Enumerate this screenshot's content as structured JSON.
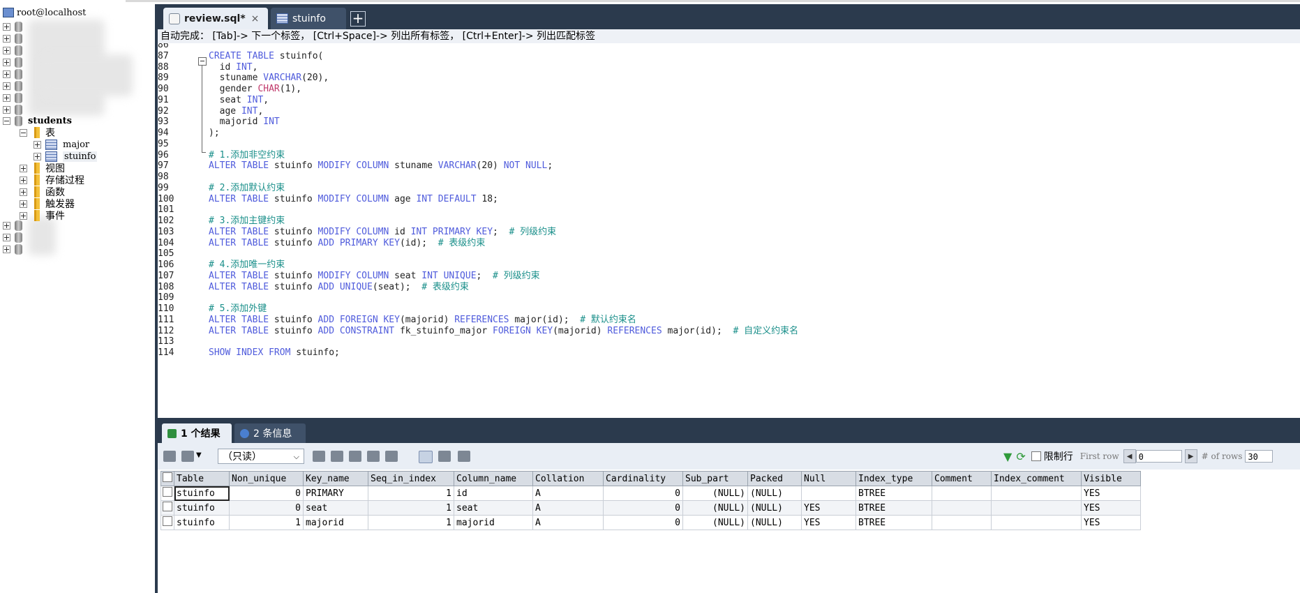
{
  "sidebar": {
    "connection": "root@localhost",
    "database": "students",
    "tables_folder": "表",
    "tables": [
      "major",
      "stuinfo"
    ],
    "folders": [
      "视图",
      "存储过程",
      "函数",
      "触发器",
      "事件"
    ]
  },
  "editor": {
    "tabs": [
      {
        "label": "review.sql*",
        "close": "×"
      },
      {
        "label": "stuinfo"
      }
    ],
    "add_tab": "+",
    "autocomplete_hint": "自动完成： [Tab]-> 下一个标签， [Ctrl+Space]-> 列出所有标签， [Ctrl+Enter]-> 列出匹配标签",
    "lines": [
      {
        "n": "86",
        "html": ""
      },
      {
        "n": "87",
        "html": "<span class='kw'>CREATE TABLE</span> <span class='pl'>stuinfo(</span>"
      },
      {
        "n": "88",
        "html": "  <span class='pl'>id</span> <span class='ty'>INT</span><span class='pl'>,</span>"
      },
      {
        "n": "89",
        "html": "  <span class='pl'>stuname</span> <span class='ty'>VARCHAR</span><span class='pl'>(20),</span>"
      },
      {
        "n": "90",
        "html": "  <span class='pl'>gender</span> <span class='ty2'>CHAR</span><span class='pl'>(1),</span>"
      },
      {
        "n": "91",
        "html": "  <span class='pl'>seat</span> <span class='ty'>INT</span><span class='pl'>,</span>"
      },
      {
        "n": "92",
        "html": "  <span class='pl'>age</span> <span class='ty'>INT</span><span class='pl'>,</span>"
      },
      {
        "n": "93",
        "html": "  <span class='pl'>majorid</span> <span class='ty'>INT</span>"
      },
      {
        "n": "94",
        "html": "<span class='pl'>);</span>"
      },
      {
        "n": "95",
        "html": ""
      },
      {
        "n": "96",
        "html": "<span class='cm'># 1.添加非空约束</span>"
      },
      {
        "n": "97",
        "html": "<span class='kw'>ALTER TABLE</span> <span class='pl'>stuinfo</span> <span class='kw'>MODIFY COLUMN</span> <span class='pl'>stuname</span> <span class='ty'>VARCHAR</span><span class='pl'>(20)</span> <span class='kw'>NOT NULL</span><span class='pl'>;</span>"
      },
      {
        "n": "98",
        "html": ""
      },
      {
        "n": "99",
        "html": "<span class='cm'># 2.添加默认约束</span>"
      },
      {
        "n": "100",
        "html": "<span class='kw'>ALTER TABLE</span> <span class='pl'>stuinfo</span> <span class='kw'>MODIFY COLUMN</span> <span class='pl'>age</span> <span class='ty'>INT</span> <span class='kw'>DEFAULT</span> <span class='pl'>18;</span>"
      },
      {
        "n": "101",
        "html": ""
      },
      {
        "n": "102",
        "html": "<span class='cm'># 3.添加主键约束</span>"
      },
      {
        "n": "103",
        "html": "<span class='kw'>ALTER TABLE</span> <span class='pl'>stuinfo</span> <span class='kw'>MODIFY COLUMN</span> <span class='pl'>id</span> <span class='ty'>INT</span> <span class='kw'>PRIMARY KEY</span><span class='pl'>;</span>  <span class='cm'># 列级约束</span>"
      },
      {
        "n": "104",
        "html": "<span class='kw'>ALTER TABLE</span> <span class='pl'>stuinfo</span> <span class='kw'>ADD PRIMARY KEY</span><span class='pl'>(id);</span>  <span class='cm'># 表级约束</span>"
      },
      {
        "n": "105",
        "html": ""
      },
      {
        "n": "106",
        "html": "<span class='cm'># 4.添加唯一约束</span>"
      },
      {
        "n": "107",
        "html": "<span class='kw'>ALTER TABLE</span> <span class='pl'>stuinfo</span> <span class='kw'>MODIFY COLUMN</span> <span class='pl'>seat</span> <span class='ty'>INT</span> <span class='kw'>UNIQUE</span><span class='pl'>;</span>  <span class='cm'># 列级约束</span>"
      },
      {
        "n": "108",
        "html": "<span class='kw'>ALTER TABLE</span> <span class='pl'>stuinfo</span> <span class='kw'>ADD UNIQUE</span><span class='pl'>(seat);</span>  <span class='cm'># 表级约束</span>"
      },
      {
        "n": "109",
        "html": ""
      },
      {
        "n": "110",
        "html": "<span class='cm'># 5.添加外键</span>"
      },
      {
        "n": "111",
        "html": "<span class='kw'>ALTER TABLE</span> <span class='pl'>stuinfo</span> <span class='kw'>ADD FOREIGN KEY</span><span class='pl'>(majorid)</span> <span class='kw'>REFERENCES</span> <span class='pl'>major(id);</span>  <span class='cm'># 默认约束名</span>"
      },
      {
        "n": "112",
        "html": "<span class='kw'>ALTER TABLE</span> <span class='pl'>stuinfo</span> <span class='kw'>ADD CONSTRAINT</span> <span class='pl'>fk_stuinfo_major</span> <span class='kw'>FOREIGN KEY</span><span class='pl'>(majorid)</span> <span class='kw'>REFERENCES</span> <span class='pl'>major(id);</span>  <span class='cm'># 自定义约束名</span>"
      },
      {
        "n": "113",
        "html": ""
      },
      {
        "n": "114",
        "html": "<span class='kw'>SHOW INDEX FROM</span> <span class='pl'>stuinfo;</span>"
      }
    ]
  },
  "results": {
    "tabs": [
      "1 个结果",
      "2 条信息"
    ],
    "readonly_select": "（只读）",
    "limit_label": "限制行",
    "first_row_label": "First row",
    "first_row_value": "0",
    "rows_label": "# of rows",
    "rows_value": "30",
    "columns": [
      "Table",
      "Non_unique",
      "Key_name",
      "Seq_in_index",
      "Column_name",
      "Collation",
      "Cardinality",
      "Sub_part",
      "Packed",
      "Null",
      "Index_type",
      "Comment",
      "Index_comment",
      "Visible"
    ],
    "numeric_columns": [
      1,
      3,
      6,
      7
    ],
    "rows": [
      [
        "stuinfo",
        "0",
        "PRIMARY",
        "1",
        "id",
        "A",
        "0",
        "(NULL)",
        "(NULL)",
        "",
        "BTREE",
        "",
        "",
        "YES"
      ],
      [
        "stuinfo",
        "0",
        "seat",
        "1",
        "seat",
        "A",
        "0",
        "(NULL)",
        "(NULL)",
        "YES",
        "BTREE",
        "",
        "",
        "YES"
      ],
      [
        "stuinfo",
        "1",
        "majorid",
        "1",
        "majorid",
        "A",
        "0",
        "(NULL)",
        "(NULL)",
        "YES",
        "BTREE",
        "",
        "",
        "YES"
      ]
    ]
  }
}
